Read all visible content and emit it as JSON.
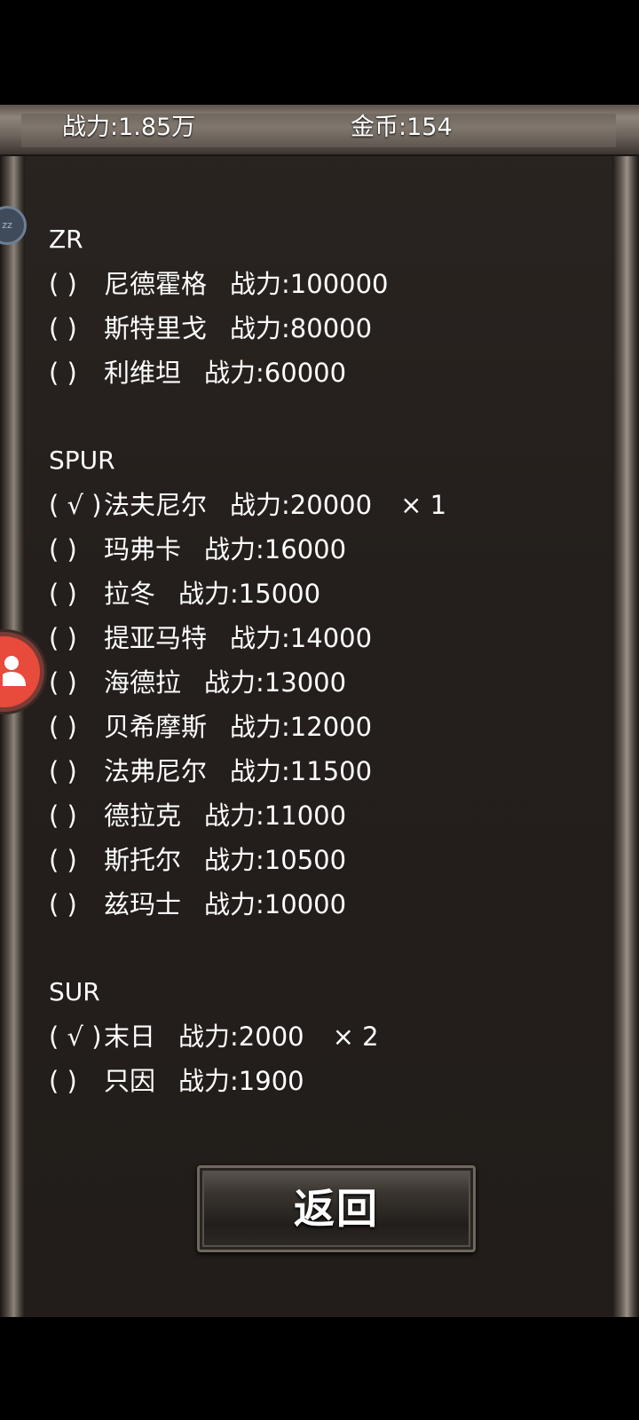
{
  "header": {
    "power": "战力:1.85万",
    "gold": "金币:154"
  },
  "sections": [
    {
      "title": "ZR",
      "items": [
        {
          "check": "(    )",
          "name": "尼德霍格",
          "power_label": "战力:",
          "power": "100000",
          "mult": ""
        },
        {
          "check": "(    )",
          "name": "斯特里戈",
          "power_label": "战力:",
          "power": "80000",
          "mult": ""
        },
        {
          "check": "(    )",
          "name": "利维坦",
          "power_label": "战力:",
          "power": "60000",
          "mult": ""
        }
      ]
    },
    {
      "title": "SPUR",
      "items": [
        {
          "check": "( √ )",
          "name": "法夫尼尔",
          "power_label": "战力:",
          "power": "20000",
          "mult": "× 1"
        },
        {
          "check": "(    )",
          "name": "玛弗卡",
          "power_label": "战力:",
          "power": "16000",
          "mult": ""
        },
        {
          "check": "(    )",
          "name": "拉冬",
          "power_label": "战力:",
          "power": "15000",
          "mult": ""
        },
        {
          "check": "(    )",
          "name": "提亚马特",
          "power_label": "战力:",
          "power": "14000",
          "mult": ""
        },
        {
          "check": "(    )",
          "name": "海德拉",
          "power_label": "战力:",
          "power": "13000",
          "mult": ""
        },
        {
          "check": "(    )",
          "name": "贝希摩斯",
          "power_label": "战力:",
          "power": "12000",
          "mult": ""
        },
        {
          "check": "(    )",
          "name": "法弗尼尔",
          "power_label": "战力:",
          "power": "11500",
          "mult": ""
        },
        {
          "check": "(    )",
          "name": "德拉克",
          "power_label": "战力:",
          "power": "11000",
          "mult": ""
        },
        {
          "check": "(    )",
          "name": "斯托尔",
          "power_label": "战力:",
          "power": "10500",
          "mult": ""
        },
        {
          "check": "(    )",
          "name": "兹玛士",
          "power_label": "战力:",
          "power": "10000",
          "mult": ""
        }
      ]
    },
    {
      "title": "SUR",
      "items": [
        {
          "check": "( √ )",
          "name": "末日",
          "power_label": "战力:",
          "power": "2000",
          "mult": "× 2"
        },
        {
          "check": "(    )",
          "name": "只因",
          "power_label": "战力:",
          "power": "1900",
          "mult": ""
        }
      ]
    }
  ],
  "back_button": {
    "label": "返回"
  },
  "side": {
    "badge_text": "zz"
  },
  "icons": {
    "user": "user-icon",
    "sleep": "sleep-badge-icon"
  }
}
